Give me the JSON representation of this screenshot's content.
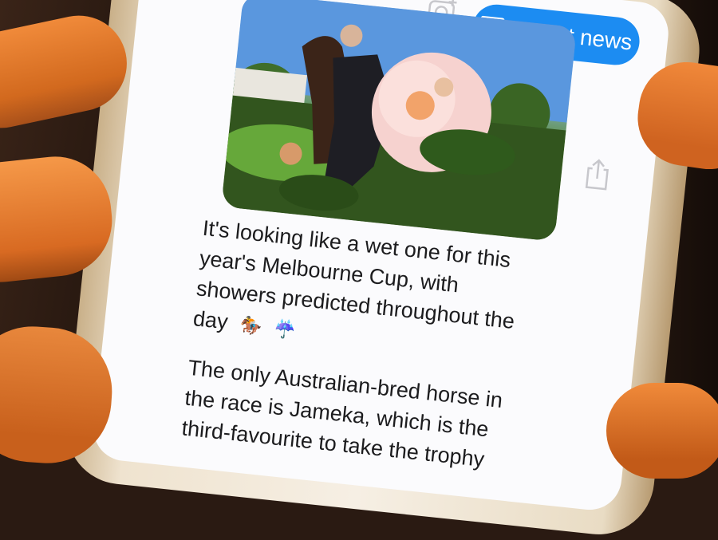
{
  "header": {
    "latest_news_label": "Latest news"
  },
  "article": {
    "paragraph_1": "It's looking like a wet one for this year's Melbourne Cup, with showers predicted throughout the day",
    "emoji_horse": "🏇",
    "emoji_umbrella": "☔",
    "paragraph_2": "The only Australian-bred horse in the race is Jameka, which is the third-favourite to take the trophy"
  },
  "icons": {
    "camera": "camera-icon",
    "news": "news-icon",
    "share": "share-icon"
  },
  "colors": {
    "accent": "#1c8cf2",
    "screen_bg": "#fbfbfd",
    "text": "#1c1c1e"
  }
}
